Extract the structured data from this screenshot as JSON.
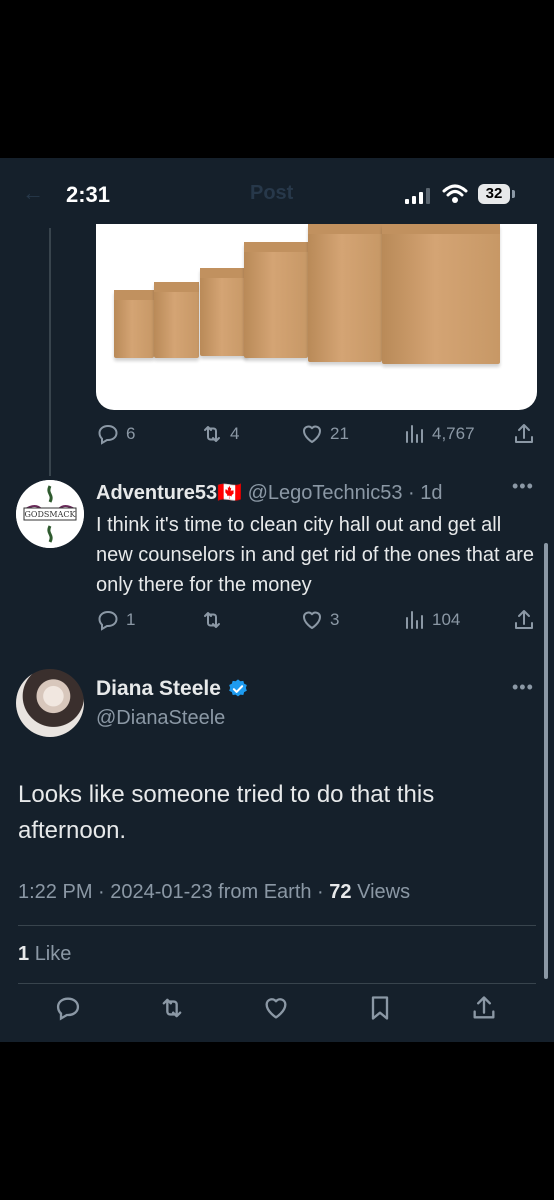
{
  "status_bar": {
    "time": "2:31",
    "ghost_title": "Post",
    "battery": "32"
  },
  "previous_post_actions": {
    "replies": "6",
    "reposts": "4",
    "likes": "21",
    "views": "4,767"
  },
  "reply": {
    "name": "Adventure53",
    "flag": "🇨🇦",
    "handle": "@LegoTechnic53",
    "age": "1d",
    "text": "I think it's time to clean city hall out and get all new counselors in and get rid of the ones that are only there for the money",
    "avatar_logo_text": "GODSMACK",
    "actions": {
      "replies": "1",
      "reposts": "",
      "likes": "3",
      "views": "104"
    }
  },
  "main_tweet": {
    "name": "Diana Steele",
    "handle": "@DianaSteele",
    "text": "Looks like someone tried to do that this afternoon.",
    "time": "1:22 PM",
    "date": "2024-01-23",
    "source": "from Earth",
    "views_count": "72",
    "views_label": "Views",
    "likes_count": "1",
    "likes_label": "Like"
  },
  "colors": {
    "background": "#15202b",
    "text": "#e7e9ea",
    "muted": "#8b98a5",
    "verified": "#1d9bf0",
    "divider": "#38444d"
  },
  "icons": [
    "reply-icon",
    "repost-icon",
    "like-icon",
    "views-icon",
    "share-icon",
    "bookmark-icon",
    "verified-icon",
    "more-icon"
  ]
}
